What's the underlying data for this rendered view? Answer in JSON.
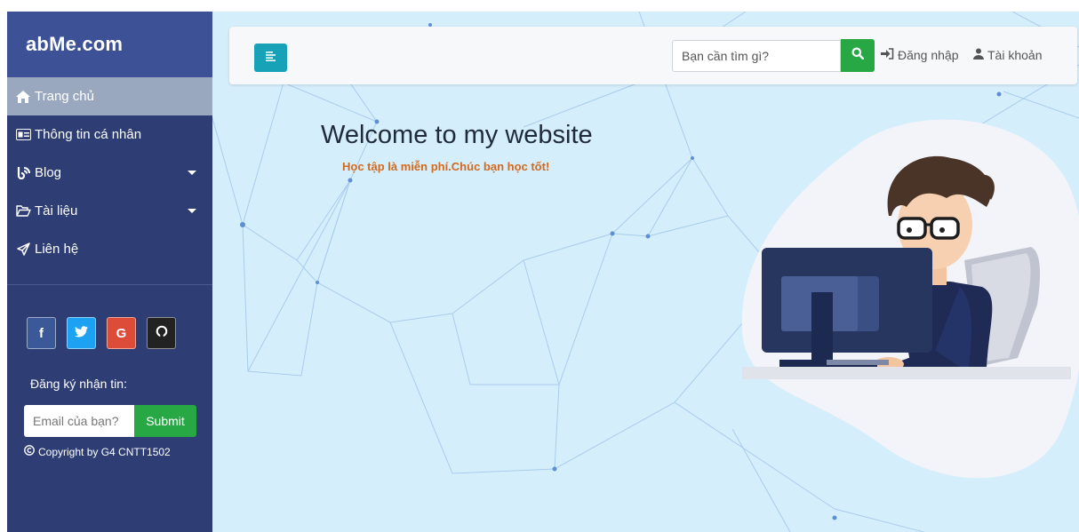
{
  "sidebar": {
    "brand": "abMe.com",
    "items": [
      {
        "label": "Trang chủ",
        "icon": "home-icon",
        "active": true
      },
      {
        "label": "Thông tin cá nhân",
        "icon": "id-card-icon"
      },
      {
        "label": "Blog",
        "icon": "blog-icon",
        "has_submenu": true
      },
      {
        "label": "Tài liệu",
        "icon": "folder-open-icon",
        "has_submenu": true
      },
      {
        "label": "Liên hệ",
        "icon": "paper-plane-icon"
      }
    ],
    "socials": [
      {
        "label": "f",
        "icon": "facebook-icon"
      },
      {
        "label": "",
        "icon": "twitter-icon"
      },
      {
        "label": "G",
        "icon": "google-icon"
      },
      {
        "label": "",
        "icon": "github-icon"
      }
    ],
    "subscribe_label": "Đăng ký nhận tin:",
    "email_placeholder": "Email của bạn?",
    "submit_label": "Submit",
    "copyright": "Copyright by G4 CNTT1502"
  },
  "topbar": {
    "search_placeholder": "Bạn cần tìm gì?",
    "login_label": "Đăng nhập",
    "account_label": "Tài khoản"
  },
  "hero": {
    "title": "Welcome to my website",
    "tagline": "Học tập là miễn phí.Chúc bạn học tốt!"
  },
  "colors": {
    "sidebar_bg": "#2e3e75",
    "brand_bg": "#3d5196",
    "active_item_bg": "#9aa8bf",
    "main_bg": "#d5eefb",
    "accent_teal": "#17a2b8",
    "accent_green": "#28a745",
    "tagline": "#d2691e"
  }
}
